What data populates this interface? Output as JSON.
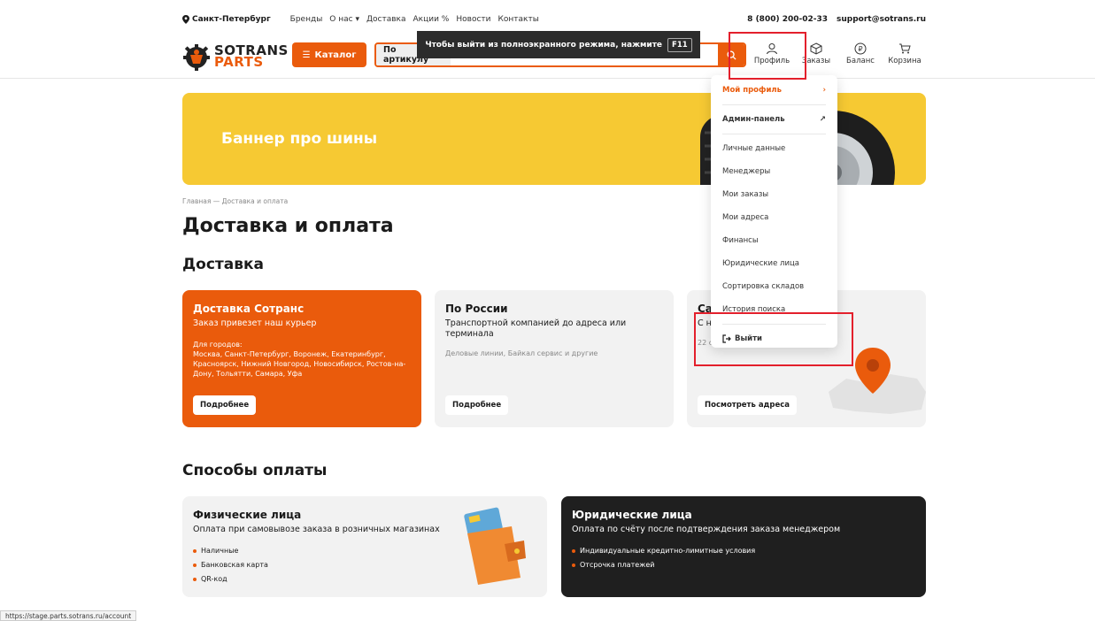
{
  "topbar": {
    "city": "Санкт-Петербург",
    "nav": [
      "Бренды",
      "О нас",
      "Доставка",
      "Акции",
      "Новости",
      "Контакты"
    ],
    "phone": "8 (800) 200-02-33",
    "email": "support@sotrans.ru"
  },
  "logo": {
    "line1": "SOTRANS",
    "line2": "PARTS"
  },
  "header": {
    "catalog": "Каталог",
    "search_type": "По артикулу",
    "search_placeholder": "Найти запчасти",
    "icons": [
      "Профиль",
      "Заказы",
      "Баланс",
      "Корзина"
    ]
  },
  "fullscreen_tip": {
    "text": "Чтобы выйти из полноэкранного режима, нажмите",
    "key": "F11"
  },
  "banner": {
    "text": "Баннер про шины"
  },
  "breadcrumb": "Главная — Доставка и оплата",
  "page_title": "Доставка и оплата",
  "delivery": {
    "title": "Доставка",
    "cards": [
      {
        "title": "Доставка Сотранс",
        "subtitle": "Заказ привезет наш курьер",
        "note_title": "Для городов:",
        "note": "Москва, Санкт-Петербург, Воронеж, Екатеринбург, Красноярск, Нижний Новгород, Новосибирск, Ростов-на-Дону, Тольятти, Самара, Уфа",
        "button": "Подробнее"
      },
      {
        "title": "По России",
        "subtitle": "Транспортной компанией до адреса или терминала",
        "note": "Деловые линии, Байкал сервис и другие",
        "button": "Подробнее"
      },
      {
        "title": "Са",
        "subtitle": "С н",
        "note": "22 с",
        "button": "Посмотреть адреса"
      }
    ]
  },
  "payment": {
    "title": "Способы оплаты",
    "cards": [
      {
        "title": "Физические лица",
        "subtitle": "Оплата при самовывозе заказа в розничных магазинах",
        "items": [
          "Наличные",
          "Банковская карта",
          "QR-код"
        ]
      },
      {
        "title": "Юридические лица",
        "subtitle": "Оплата по счёту после подтверждения заказа менеджером",
        "items": [
          "Индивидуальные кредитно-лимитные условия",
          "Отсрочка платежей"
        ]
      }
    ]
  },
  "dropdown": {
    "my_profile": "Мой профиль",
    "admin": "Админ-панель",
    "items": [
      "Личные данные",
      "Менеджеры",
      "Мои заказы",
      "Мои адреса",
      "Финансы",
      "Юридические лица",
      "Сортировка складов",
      "История поиска"
    ],
    "logout": "Выйти"
  },
  "status_url": "https://stage.parts.sotrans.ru/account",
  "colors": {
    "accent": "#ea5b0c",
    "banner": "#f6c933",
    "highlight": "#e3202c"
  }
}
